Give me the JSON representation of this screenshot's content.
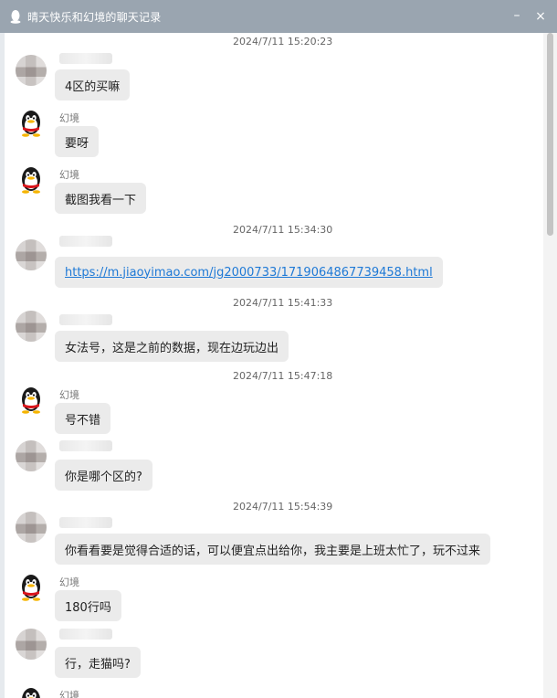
{
  "window": {
    "title": "晴天快乐和幻境的聊天记录",
    "minimize_glyph": "–",
    "close_glyph": "×"
  },
  "timestamps": [
    "2024/7/11 15:20:23",
    "2024/7/11 15:34:30",
    "2024/7/11 15:41:33",
    "2024/7/11 15:47:18",
    "2024/7/11 15:54:39"
  ],
  "contact_name": "幻境",
  "messages": [
    {
      "sender": "other",
      "text": "4区的买嘛"
    },
    {
      "sender": "self",
      "text": "要呀"
    },
    {
      "sender": "self",
      "text": "截图我看一下"
    },
    {
      "sender": "other",
      "text": "https://m.jiaoyimao.com/jg2000733/1719064867739458.html"
    },
    {
      "sender": "other",
      "text": "女法号，这是之前的数据，现在边玩边出"
    },
    {
      "sender": "self",
      "text": "号不错"
    },
    {
      "sender": "other",
      "text": "你是哪个区的?"
    },
    {
      "sender": "other",
      "text": "你看看要是觉得合适的话，可以便宜点出给你，我主要是上班太忙了，玩不过来"
    },
    {
      "sender": "self",
      "text": "180行吗"
    },
    {
      "sender": "other",
      "text": "行，走猫吗?"
    },
    {
      "sender": "self",
      "text": ""
    }
  ]
}
